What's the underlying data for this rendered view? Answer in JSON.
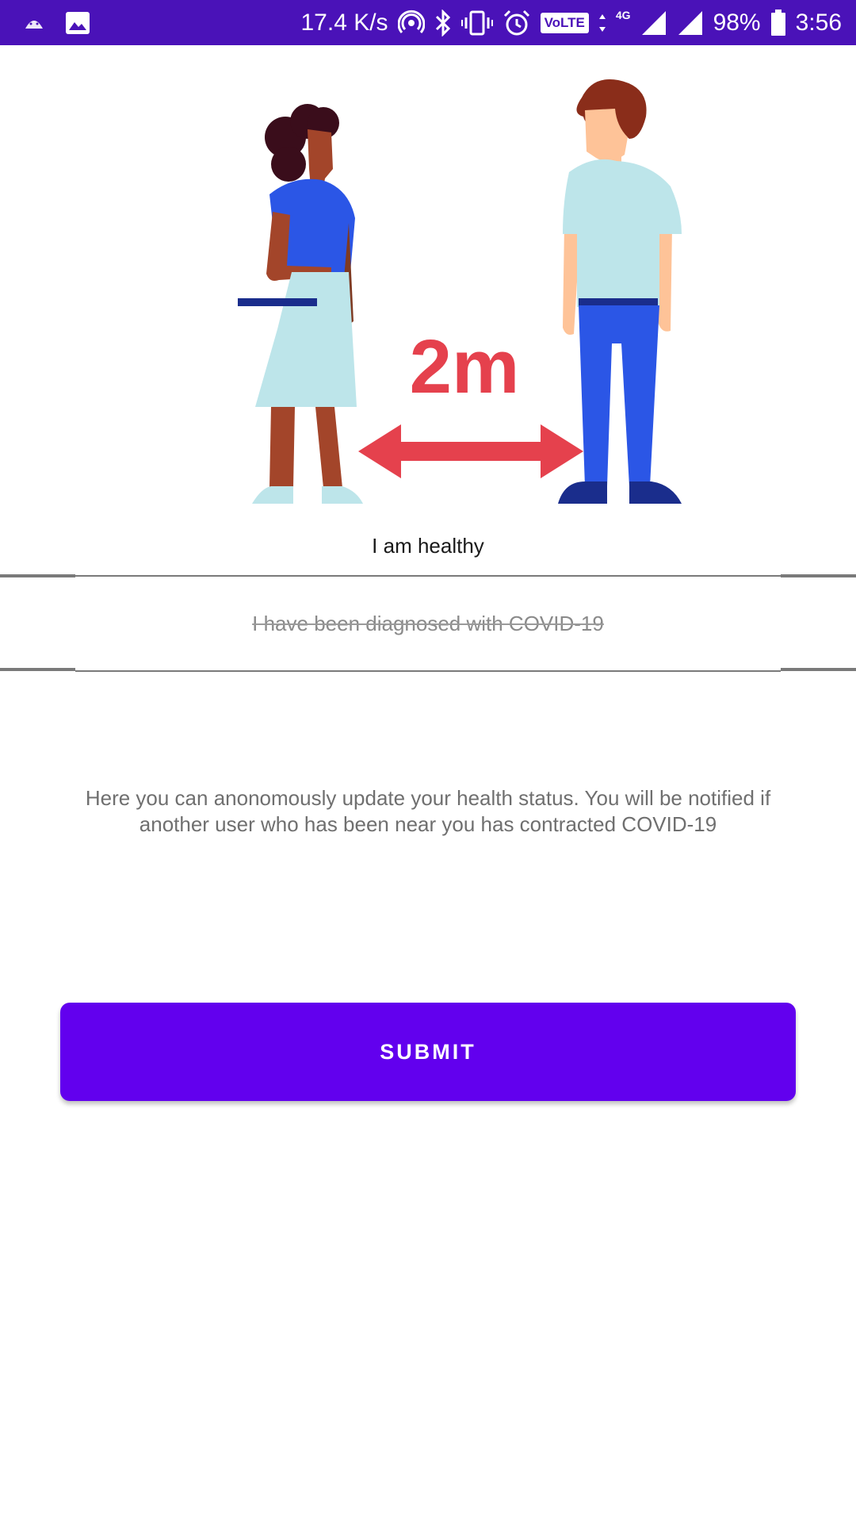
{
  "status_bar": {
    "net_speed": "17.4 K/s",
    "volte": "VoLTE",
    "network": "4G",
    "battery": "98%",
    "time": "3:56"
  },
  "illustration": {
    "distance_label": "2m"
  },
  "options": {
    "healthy": "I am healthy",
    "diagnosed": "I have been diagnosed with COVID-19"
  },
  "info": {
    "text": "Here you can anonomously update your health status. You will be notified if another user who has been near you has contracted COVID-19"
  },
  "submit": {
    "label": "SUBMIT"
  },
  "colors": {
    "status_bar": "#4a12b8",
    "accent": "#6200ee",
    "arrow": "#e5414d"
  }
}
